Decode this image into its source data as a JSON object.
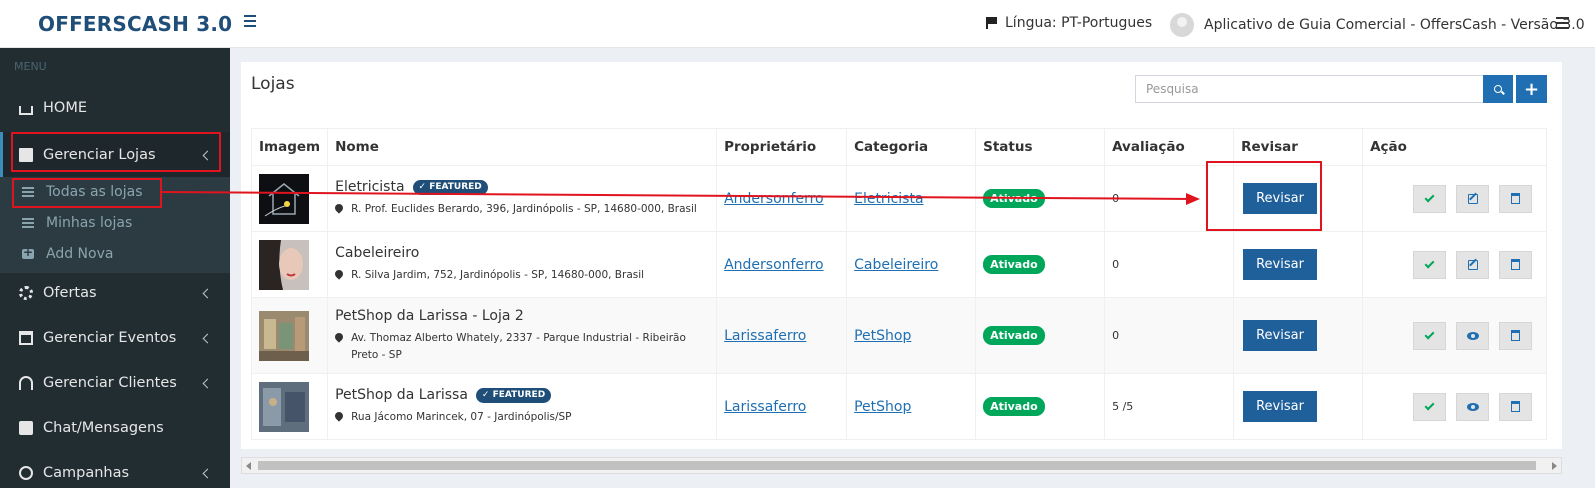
{
  "header": {
    "brand": "OFFERSCASH 3.0",
    "language": "Língua: PT-Portugues",
    "app_title": "Aplicativo de Guia Comercial - OffersCash - Versão 3.0"
  },
  "sidebar": {
    "menu_header": "MENU",
    "items": [
      {
        "label": "HOME",
        "icon": "home-icon"
      },
      {
        "label": "Gerenciar Lojas",
        "icon": "store-icon"
      },
      {
        "label": "Ofertas",
        "icon": "cog-icon"
      },
      {
        "label": "Gerenciar Eventos",
        "icon": "calendar-icon"
      },
      {
        "label": "Gerenciar Clientes",
        "icon": "users-icon"
      },
      {
        "label": "Chat/Mensagens",
        "icon": "chat-icon"
      },
      {
        "label": "Campanhas",
        "icon": "target-icon"
      }
    ],
    "submenu": [
      {
        "label": "Todas as lojas",
        "icon": "list-icon"
      },
      {
        "label": "Minhas lojas",
        "icon": "list-icon"
      },
      {
        "label": "Add Nova",
        "icon": "plus-square-icon"
      }
    ]
  },
  "main": {
    "title": "Lojas",
    "search": {
      "placeholder": "Pesquisa"
    },
    "add_label": "+",
    "columns": [
      "Imagem",
      "Nome",
      "Proprietário",
      "Categoria",
      "Status",
      "Avaliação",
      "Revisar",
      "Ação"
    ],
    "rows": [
      {
        "name": "Eletricista",
        "featured": "FEATURED",
        "address": "R. Prof. Euclides Berardo, 396, Jardinópolis - SP, 14680-000, Brasil",
        "owner": "Andersonferro",
        "category": "Eletricista",
        "status": "Ativado",
        "rating": "0",
        "review": "Revisar",
        "view_icon": "edit-icon"
      },
      {
        "name": "Cabeleireiro",
        "featured": "",
        "address": "R. Silva Jardim, 752, Jardinópolis - SP, 14680-000, Brasil",
        "owner": "Andersonferro",
        "category": "Cabeleireiro",
        "status": "Ativado",
        "rating": "0",
        "review": "Revisar",
        "view_icon": "edit-icon"
      },
      {
        "name": "PetShop da Larissa - Loja 2",
        "featured": "",
        "address": "Av. Thomaz Alberto Whately, 2337 - Parque Industrial - Ribeirão Preto - SP",
        "owner": "Larissaferro",
        "category": "PetShop",
        "status": "Ativado",
        "rating": "0",
        "review": "Revisar",
        "view_icon": "eye-icon"
      },
      {
        "name": "PetShop da Larissa",
        "featured": "FEATURED",
        "address": "Rua Jácomo Marincek, 07 - Jardinópolis/SP",
        "owner": "Larissaferro",
        "category": "PetShop",
        "status": "Ativado",
        "rating": "5 /5",
        "review": "Revisar",
        "view_icon": "eye-icon"
      }
    ]
  },
  "colors": {
    "brand": "#1f4e79",
    "sidebar_bg": "#222d32",
    "accent": "#1f6fb2",
    "status_green": "#00a65a",
    "annotation_red": "#e0141e"
  }
}
